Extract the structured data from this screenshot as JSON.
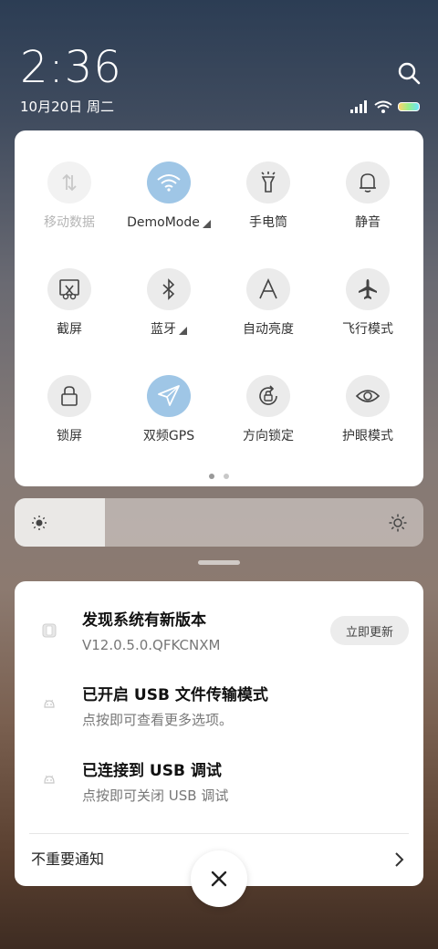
{
  "status": {
    "time": "2:36",
    "date": "10月20日 周二",
    "icons": [
      "signal-icon",
      "wifi-icon",
      "battery-icon"
    ],
    "search_icon": "search-icon"
  },
  "quick_settings": {
    "tiles": [
      {
        "label": "移动数据",
        "icon": "mobile-data-icon",
        "state": "disabled"
      },
      {
        "label": "DemoMode",
        "icon": "wifi-icon",
        "state": "active",
        "expandable": true
      },
      {
        "label": "手电筒",
        "icon": "flashlight-icon",
        "state": "off"
      },
      {
        "label": "静音",
        "icon": "bell-icon",
        "state": "off"
      },
      {
        "label": "截屏",
        "icon": "screenshot-icon",
        "state": "off"
      },
      {
        "label": "蓝牙",
        "icon": "bluetooth-icon",
        "state": "off",
        "expandable": true
      },
      {
        "label": "自动亮度",
        "icon": "auto-brightness-icon",
        "state": "off"
      },
      {
        "label": "飞行模式",
        "icon": "airplane-icon",
        "state": "off"
      },
      {
        "label": "锁屏",
        "icon": "lock-icon",
        "state": "off"
      },
      {
        "label": "双频GPS",
        "icon": "gps-icon",
        "state": "active"
      },
      {
        "label": "方向锁定",
        "icon": "rotation-lock-icon",
        "state": "off"
      },
      {
        "label": "护眼模式",
        "icon": "eye-icon",
        "state": "off"
      }
    ],
    "page_indicator": {
      "current": 1,
      "total": 2
    }
  },
  "brightness": {
    "level": 0.22
  },
  "notifications": {
    "items": [
      {
        "title": "发现系统有新版本",
        "subtitle": "V12.0.5.0.QFKCNXM",
        "action": "立即更新",
        "icon": "system-update-icon"
      },
      {
        "title": "已开启 USB 文件传输模式",
        "subtitle": "点按即可查看更多选项。",
        "icon": "android-icon"
      },
      {
        "title": "已连接到 USB 调试",
        "subtitle": "点按即可关闭 USB 调试",
        "icon": "android-icon"
      }
    ],
    "footer_label": "不重要通知"
  },
  "colors": {
    "active_tile": "#9fc6e6",
    "tile_bg": "#ebebeb"
  }
}
